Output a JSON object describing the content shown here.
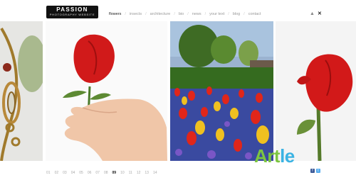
{
  "logo": {
    "main": "PASSION",
    "sub": "PHOTOGRAPHY WEBSITE"
  },
  "nav": {
    "items": [
      {
        "label": "flowers",
        "active": true
      },
      {
        "label": "insects"
      },
      {
        "label": "architecture"
      },
      {
        "label": "bio"
      },
      {
        "label": "news"
      },
      {
        "label": "your text"
      },
      {
        "label": "blog"
      },
      {
        "label": "contact"
      }
    ],
    "separator": "/"
  },
  "icons": {
    "person": "person-icon",
    "close": "close-icon"
  },
  "gallery": {
    "photos": [
      {
        "subject": "ornate gold pendant jewelry"
      },
      {
        "subject": "hand holding red rose"
      },
      {
        "subject": "tulip garden field"
      },
      {
        "subject": "red rose bud"
      }
    ]
  },
  "pager": {
    "pages": [
      "01",
      "02",
      "03",
      "04",
      "05",
      "06",
      "07",
      "08",
      "09",
      "10",
      "11",
      "12",
      "13",
      "14"
    ],
    "active_page": "09"
  },
  "watermark": {
    "part1": "Art",
    "part2": "le",
    "fb": "f",
    "tw": "t"
  }
}
